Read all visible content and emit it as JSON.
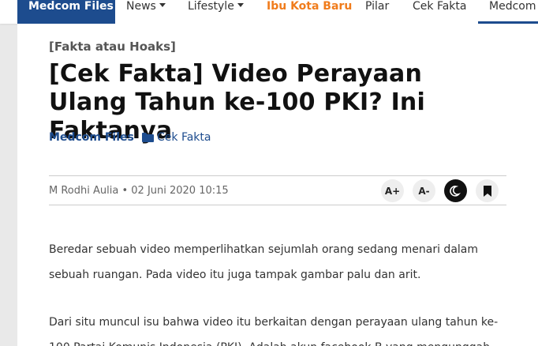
{
  "nav": {
    "brand": "Medcom Files",
    "items": [
      {
        "label": "News",
        "caret": true,
        "color": "#333333"
      },
      {
        "label": "Lifestyle",
        "caret": true,
        "color": "#333333"
      },
      {
        "label": "Ibu Kota Baru",
        "caret": false,
        "color": "#f07c1c"
      },
      {
        "label": "Pilar",
        "caret": false,
        "color": "#333333"
      },
      {
        "label": "Cek Fakta",
        "caret": false,
        "color": "#333333"
      },
      {
        "label": "Medcom",
        "caret": false,
        "color": "#333333"
      }
    ]
  },
  "article": {
    "category": "[Fakta atau Hoaks]",
    "title": "[Cek Fakta] Video Perayaan Ulang Tahun ke-100 PKI? Ini Faktanya",
    "source": "Medcom Files",
    "section": "Cek Fakta",
    "author": "M Rodhi Aulia",
    "separator": "•",
    "date": "02 Juni 2020 10:15",
    "paragraphs": [
      "Beredar sebuah video memperlihatkan sejumlah orang sedang menari dalam sebuah ruangan. Pada video itu juga tampak gambar palu dan arit.",
      "Dari situ muncul isu bahwa video itu berkaitan dengan perayaan ulang tahun ke-100 Partai Komunis Indonesia (PKI). Adalah akun facebook B yang mengunggah"
    ]
  },
  "tools": {
    "increase_font": "A+",
    "decrease_font": "A-"
  },
  "colors": {
    "brand": "#1d4c8e",
    "accent": "#f07c1c"
  }
}
